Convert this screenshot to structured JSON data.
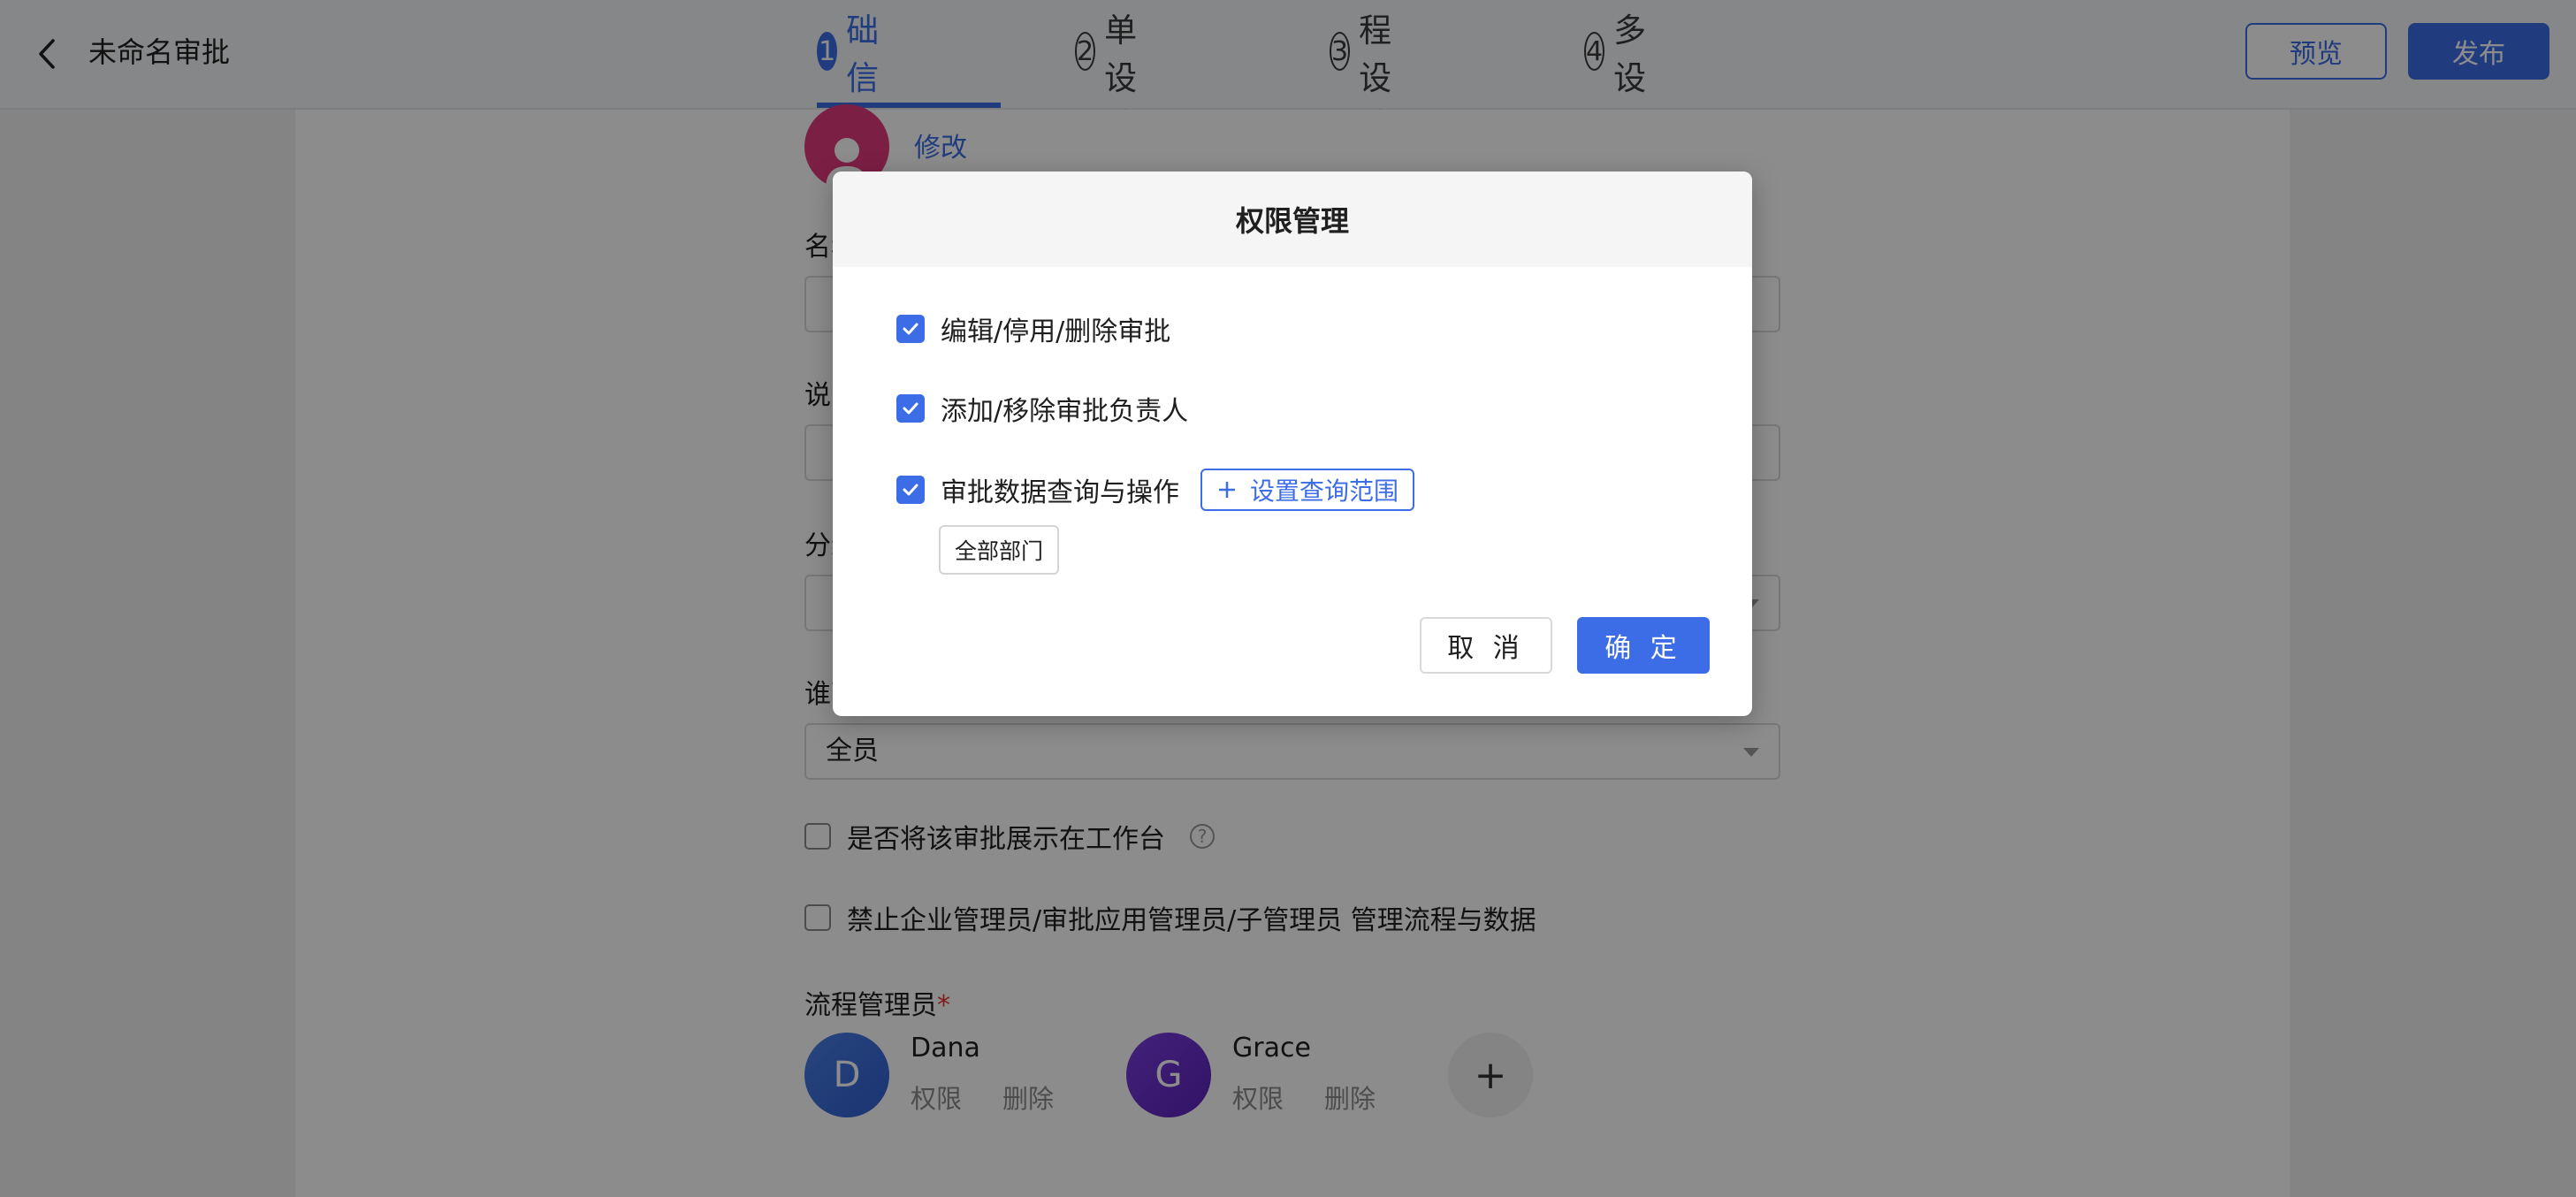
{
  "header": {
    "title": "未命名审批",
    "steps": [
      {
        "num": "1",
        "label": "基础信息"
      },
      {
        "num": "2",
        "label": "表单设计"
      },
      {
        "num": "3",
        "label": "流程设计"
      },
      {
        "num": "4",
        "label": "更多设置"
      }
    ],
    "active_step": 1,
    "preview_label": "预览",
    "publish_label": "发布"
  },
  "form": {
    "modify_label": "修改",
    "name_label": "名称",
    "desc_label": "说明",
    "group_label": "分组",
    "visible_label": "谁可以发起",
    "visible_value": "全员",
    "show_on_workbench": "是否将该审批展示在工作台",
    "forbid_admin": "禁止企业管理员/审批应用管理员/子管理员 管理流程与数据",
    "managers_label": "流程管理员",
    "required_mark": "*",
    "managers": [
      {
        "initial": "D",
        "name": "Dana",
        "perm_label": "权限",
        "delete_label": "删除",
        "color": "#3b6fd8"
      },
      {
        "initial": "G",
        "name": "Grace",
        "perm_label": "权限",
        "delete_label": "删除",
        "color": "#6a2fc7"
      }
    ],
    "add_manager": "+"
  },
  "modal": {
    "title": "权限管理",
    "permissions": [
      {
        "label": "编辑/停用/删除审批",
        "checked": true
      },
      {
        "label": "添加/移除审批负责人",
        "checked": true
      },
      {
        "label": "审批数据查询与操作",
        "checked": true
      }
    ],
    "set_scope_label": "设置查询范围",
    "scope_tag": "全部部门",
    "cancel_label": "取 消",
    "ok_label": "确 定"
  },
  "colors": {
    "accent": "#3d6de6",
    "avatar_pink": "#e23a7e",
    "required": "#e5322d"
  }
}
